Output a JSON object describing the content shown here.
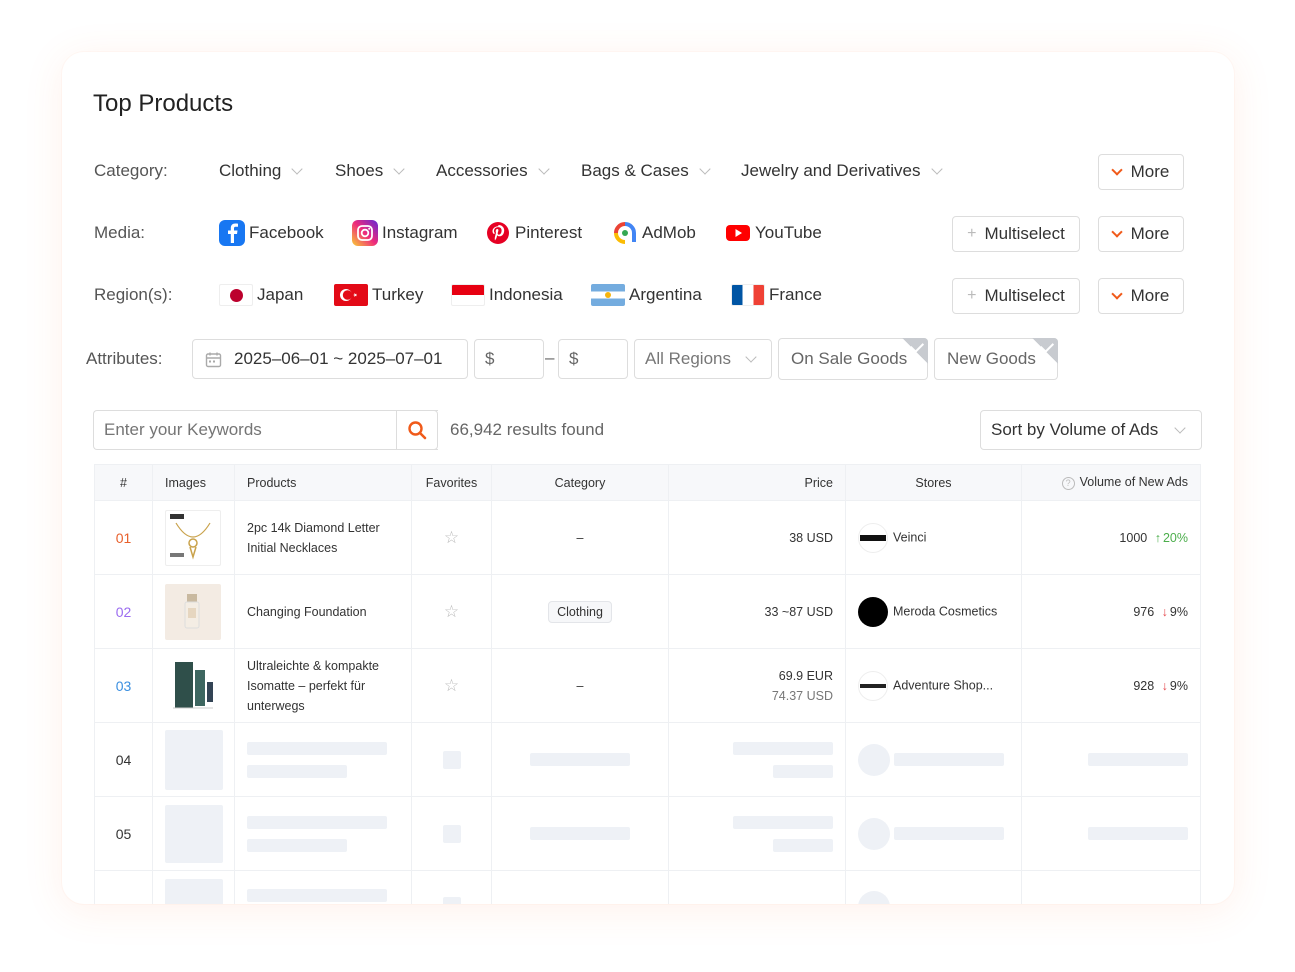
{
  "title": "Top Products",
  "filters": {
    "category": {
      "label": "Category:",
      "options": [
        "Clothing",
        "Shoes",
        "Accessories",
        "Bags & Cases",
        "Jewelry and Derivatives"
      ],
      "more_label": "More"
    },
    "media": {
      "label": "Media:",
      "options": [
        "Facebook",
        "Instagram",
        "Pinterest",
        "AdMob",
        "YouTube"
      ],
      "multiselect_label": "Multiselect",
      "more_label": "More"
    },
    "regions": {
      "label": "Region(s):",
      "options": [
        "Japan",
        "Turkey",
        "Indonesia",
        "Argentina",
        "France"
      ],
      "multiselect_label": "Multiselect",
      "more_label": "More"
    },
    "attributes": {
      "label": "Attributes:",
      "date_range": "2025–06–01 ~ 2025–07–01",
      "price_min_prefix": "$",
      "price_max_prefix": "$",
      "price_separator": "–",
      "regions_select": "All Regions",
      "on_sale": "On Sale Goods",
      "new_goods": "New Goods"
    }
  },
  "search": {
    "placeholder": "Enter your Keywords",
    "results_text": "66,942 results found",
    "sort_label": "Sort by Volume of Ads"
  },
  "table": {
    "headers": {
      "rank": "#",
      "images": "Images",
      "products": "Products",
      "favorites": "Favorites",
      "category": "Category",
      "price": "Price",
      "stores": "Stores",
      "volume": "Volume of New Ads"
    },
    "rows": [
      {
        "rank": "01",
        "rank_color": "#e8602c",
        "product": "2pc 14k Diamond Letter Initial Necklaces",
        "category": "–",
        "price": "38 USD",
        "price2": "",
        "store": "Veinci",
        "volume": "1000",
        "trend": "up",
        "change": "20%"
      },
      {
        "rank": "02",
        "rank_color": "#9b6cf0",
        "product": "Changing Foundation",
        "category": "Clothing",
        "price": "33 ~87 USD",
        "price2": "",
        "store": "Meroda Cosmetics",
        "volume": "976",
        "trend": "down",
        "change": "9%"
      },
      {
        "rank": "03",
        "rank_color": "#3b8fe0",
        "product": "Ultraleichte & kompakte Isomatte – perfekt für unterwegs",
        "category": "–",
        "price": "69.9 EUR",
        "price2": "74.37 USD",
        "store": "Adventure Shop...",
        "volume": "928",
        "trend": "down",
        "change": "9%"
      }
    ],
    "placeholder_ranks": [
      "04",
      "05"
    ]
  },
  "colors": {
    "accent": "#f05a1a",
    "up": "#4cae4c",
    "down": "#e5484d"
  }
}
